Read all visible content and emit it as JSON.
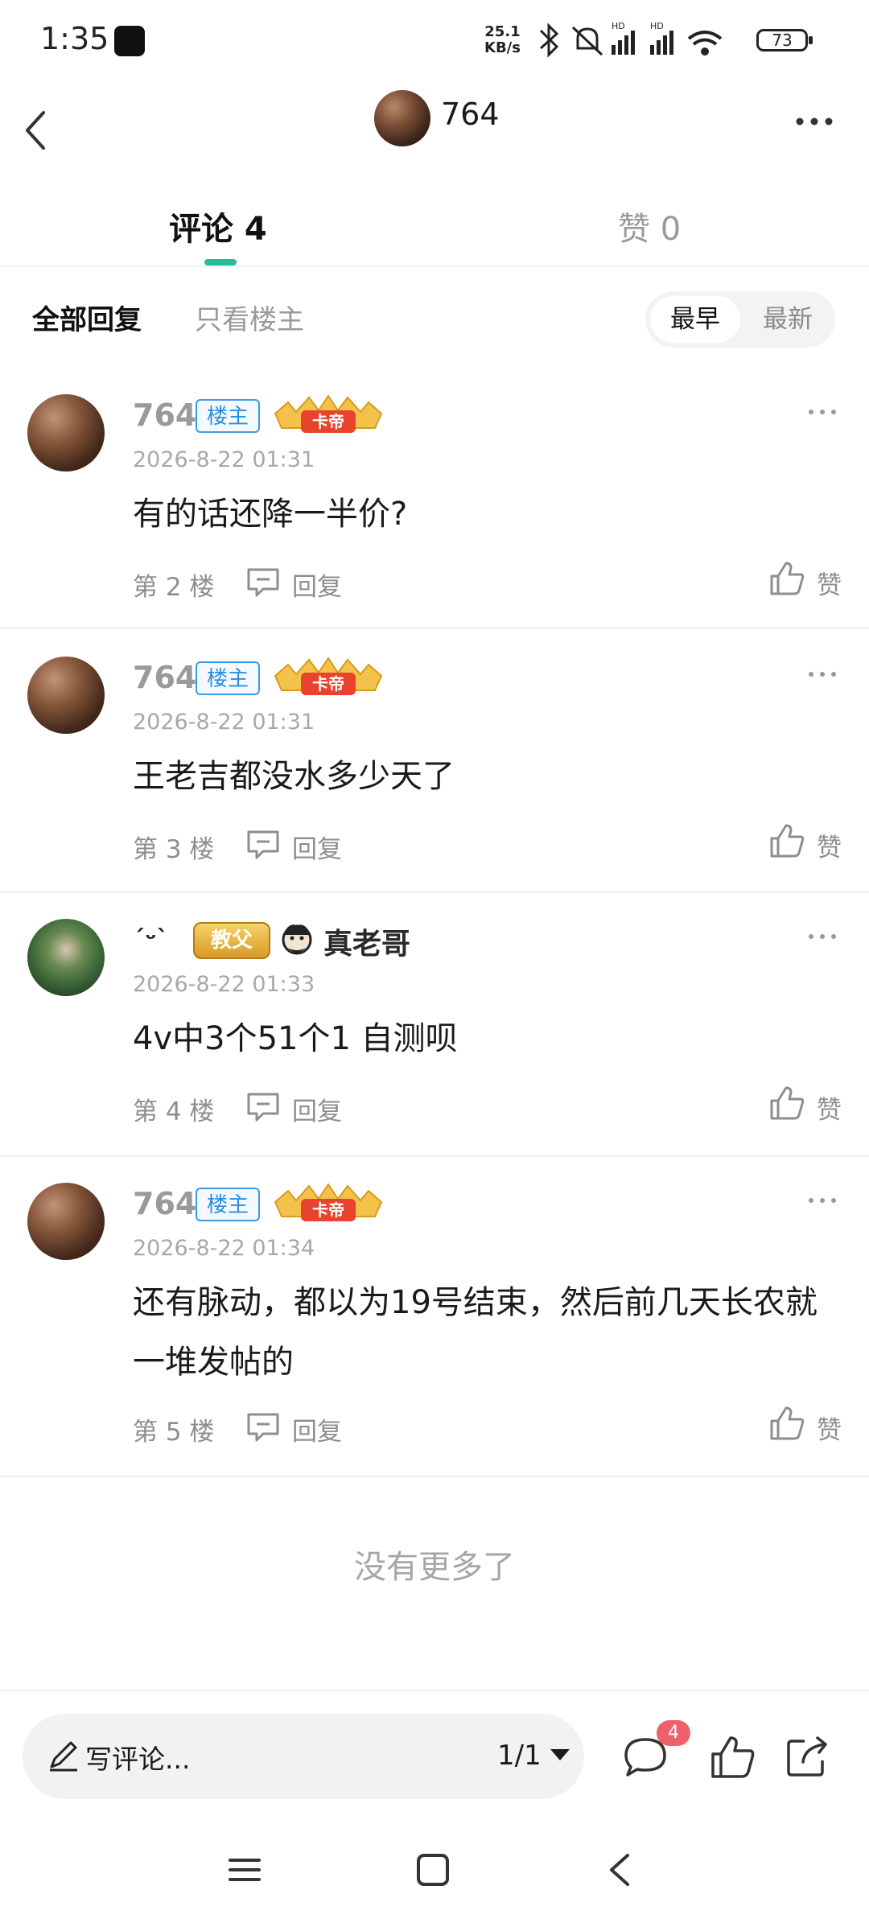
{
  "status_bar": {
    "time": "1:35",
    "net_speed_value": "25.1",
    "net_speed_unit": "KB/s",
    "battery": "73"
  },
  "header": {
    "username": "764"
  },
  "tabs": {
    "comments": "评论 4",
    "likes": "赞 0"
  },
  "filter": {
    "all": "全部回复",
    "owner_only": "只看楼主",
    "sort_earliest": "最早",
    "sort_latest": "最新"
  },
  "comments": [
    {
      "user": "764",
      "owner_badge": "楼主",
      "level_badge": "卡帝",
      "time": "2026-8-22 01:31",
      "text": "有的话还降一半价?",
      "floor": "第 2 楼",
      "reply": "回复",
      "like": "赞"
    },
    {
      "user": "764",
      "owner_badge": "楼主",
      "level_badge": "卡帝",
      "time": "2026-8-22 01:31",
      "text": "王老吉都没水多少天了",
      "floor": "第 3 楼",
      "reply": "回复",
      "like": "赞"
    },
    {
      "user": "ˊᵕˋ",
      "level_badge": "教父",
      "title": "真老哥",
      "time": "2026-8-22 01:33",
      "text": "4v中3个51个1 自测呗",
      "floor": "第 4 楼",
      "reply": "回复",
      "like": "赞"
    },
    {
      "user": "764",
      "owner_badge": "楼主",
      "level_badge": "卡帝",
      "time": "2026-8-22 01:34",
      "text": "还有脉动，都以为19号结束，然后前几天长农就一堆发帖的",
      "floor": "第 5 楼",
      "reply": "回复",
      "like": "赞"
    }
  ],
  "end_text": "没有更多了",
  "bottom_bar": {
    "write_placeholder": "写评论...",
    "page": "1/1",
    "comment_count": "4"
  },
  "colors": {
    "accent": "#29b99b",
    "owner_badge": "#2b8fe0",
    "notification": "#f0606a"
  },
  "icons": [
    "back-icon",
    "more-icon",
    "reply-icon",
    "like-icon",
    "pencil-icon",
    "comment-icon",
    "share-icon",
    "menu-icon",
    "home-icon",
    "nav-back-icon"
  ]
}
